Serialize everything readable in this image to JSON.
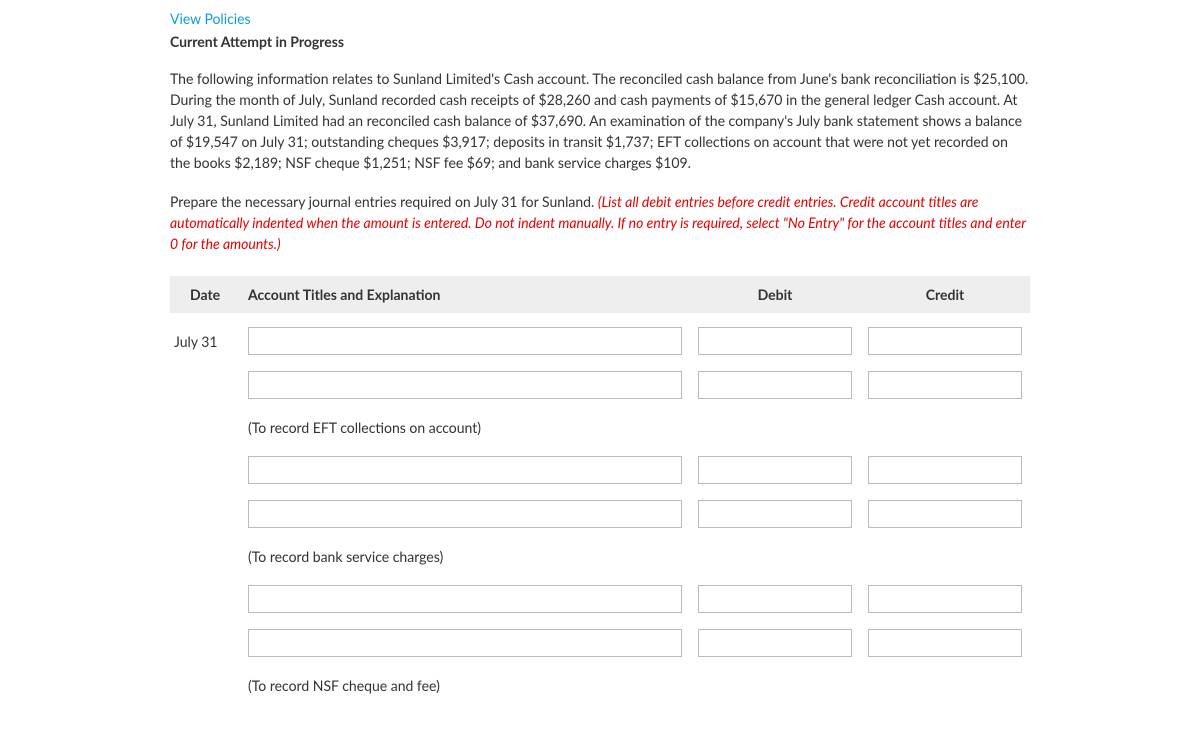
{
  "links": {
    "view_policies": "View Policies"
  },
  "headings": {
    "current_attempt": "Current Attempt in Progress"
  },
  "problem_text": "The following information relates to Sunland Limited's Cash account. The reconciled cash balance from June's bank reconciliation is $25,100. During the month of July, Sunland recorded cash receipts of $28,260 and cash payments of $15,670 in the general ledger Cash account. At July 31, Sunland Limited had an reconciled cash balance of $37,690. An examination of the company's July bank statement shows a balance of $19,547 on July 31; outstanding cheques $3,917; deposits in transit $1,737; EFT collections on account that were not yet recorded on the books $2,189; NSF cheque $1,251; NSF fee $69; and bank service charges $109.",
  "instruction_plain": "Prepare the necessary journal entries required on July 31 for Sunland. ",
  "instruction_red": "(List all debit entries before credit entries. Credit account titles are automatically indented when the amount is entered. Do not indent manually. If no entry is required, select \"No Entry\" for the account titles and enter 0 for the amounts.)",
  "table": {
    "headers": {
      "date": "Date",
      "account": "Account Titles and Explanation",
      "debit": "Debit",
      "credit": "Credit"
    },
    "date_value": "July 31",
    "explanations": {
      "e1": "(To record EFT collections on account)",
      "e2": "(To record bank service charges)",
      "e3": "(To record NSF cheque and fee)"
    }
  }
}
